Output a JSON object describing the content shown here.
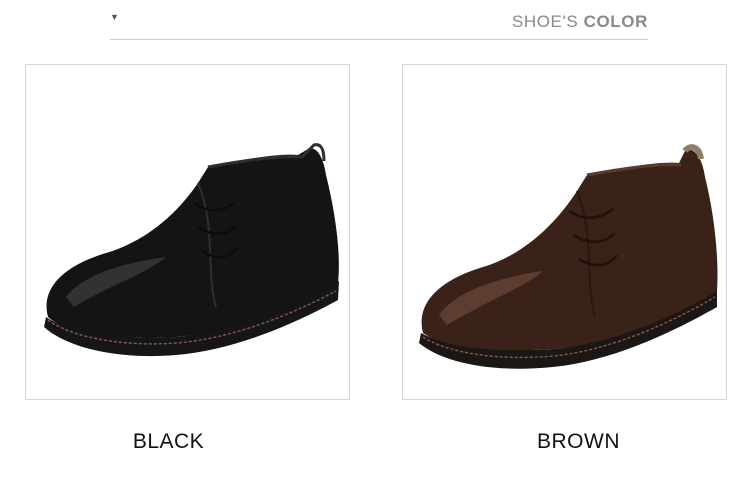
{
  "header": {
    "marker_icon": "triangle-down-icon",
    "title_light": "SHOE'S",
    "title_bold": "COLOR"
  },
  "products": [
    {
      "label": "BLACK",
      "color": "#141414",
      "shade": "#2e2e2e"
    },
    {
      "label": "BROWN",
      "color": "#3b2218",
      "shade": "#5a3a2c"
    }
  ]
}
